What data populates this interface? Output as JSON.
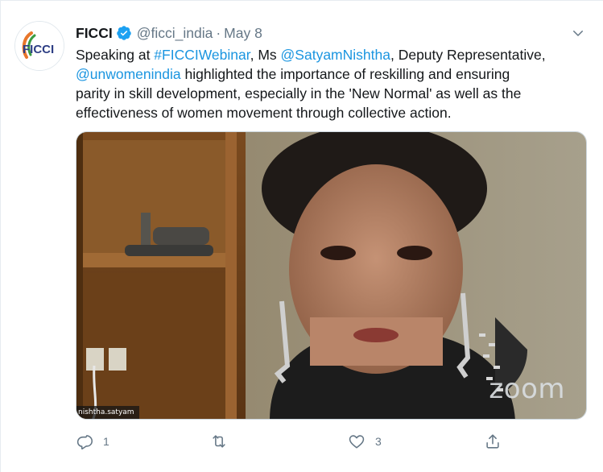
{
  "tweet": {
    "display_name": "FICCI",
    "handle": "@ficci_india",
    "separator": "·",
    "date": "May 8",
    "avatar_text": "FICCI",
    "text_lines": [
      [
        {
          "t": "Speaking at ",
          "link": false
        },
        {
          "t": "#FICCIWebinar",
          "link": true
        },
        {
          "t": ", Ms ",
          "link": false
        },
        {
          "t": "@SatyamNishtha",
          "link": true
        },
        {
          "t": ", Deputy Representative,",
          "link": false
        }
      ],
      [
        {
          "t": "@unwomenindia",
          "link": true
        },
        {
          "t": " highlighted the importance of reskilling and ensuring",
          "link": false
        }
      ],
      [
        {
          "t": "parity in skill development, especially in the 'New Normal' as well as the",
          "link": false
        }
      ],
      [
        {
          "t": "effectiveness of women movement through collective action.",
          "link": false
        }
      ]
    ],
    "media": {
      "watermark": "zoom",
      "participant_name": "nishtha.satyam"
    },
    "actions": {
      "reply_count": "1",
      "retweet_count": "",
      "like_count": "3"
    }
  },
  "colors": {
    "link": "#1b95e0",
    "secondary_text": "#657786",
    "verified": "#1da1f2"
  },
  "icons": [
    "ficci-logo-icon",
    "verified-badge-icon",
    "chevron-down-icon",
    "reply-icon",
    "retweet-icon",
    "like-icon",
    "share-icon"
  ]
}
